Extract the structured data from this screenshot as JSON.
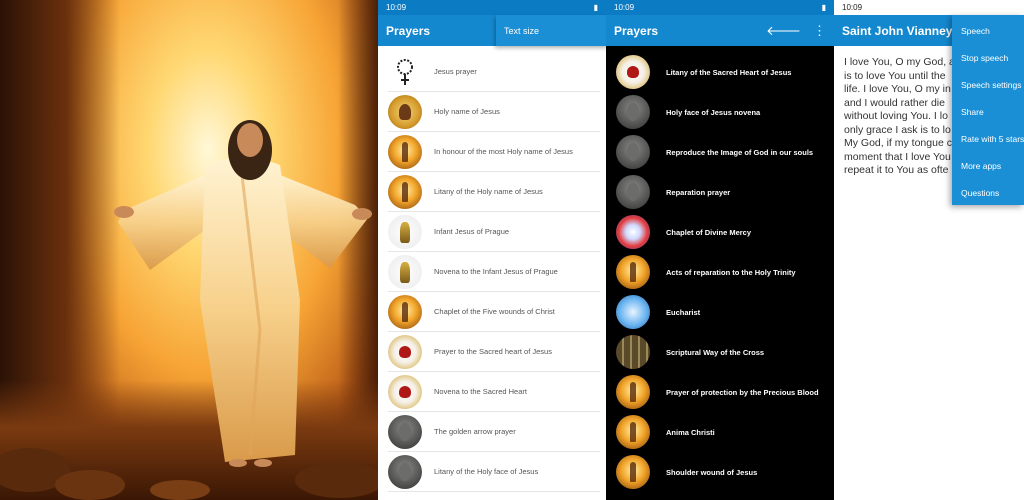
{
  "panel2": {
    "status_time": "10:09",
    "title": "Prayers",
    "popup_label": "Text size",
    "items": [
      {
        "label": "Jesus prayer",
        "icon": "rosary-icon"
      },
      {
        "label": "Holy name of Jesus",
        "icon": "christ-icon"
      },
      {
        "label": "In honour of the most Holy name of Jesus",
        "icon": "risen-christ-icon"
      },
      {
        "label": "Litany of the Holy name of Jesus",
        "icon": "risen-christ-icon"
      },
      {
        "label": "Infant Jesus of Prague",
        "icon": "infant-jesus-icon"
      },
      {
        "label": "Novena to the Infant Jesus of Prague",
        "icon": "infant-jesus-icon"
      },
      {
        "label": "Chaplet of the Five wounds of Christ",
        "icon": "risen-christ-icon"
      },
      {
        "label": "Prayer to the Sacred heart of Jesus",
        "icon": "sacred-heart-icon"
      },
      {
        "label": "Novena to the Sacred Heart",
        "icon": "sacred-heart-icon"
      },
      {
        "label": "The golden arrow prayer",
        "icon": "holy-face-icon"
      },
      {
        "label": "Litany of the Holy face of Jesus",
        "icon": "holy-face-icon"
      }
    ]
  },
  "panel3": {
    "status_time": "10:09",
    "title": "Prayers",
    "back_glyph": "🡐",
    "more_glyph": "⋮",
    "items": [
      {
        "label": "Litany of the Sacred Heart of Jesus",
        "icon": "sacred-heart-icon"
      },
      {
        "label": "Holy face of Jesus novena",
        "icon": "holy-face-icon"
      },
      {
        "label": "Reproduce the Image of God in our souls",
        "icon": "holy-face-icon"
      },
      {
        "label": "Reparation prayer",
        "icon": "holy-face-icon"
      },
      {
        "label": "Chaplet of Divine Mercy",
        "icon": "divine-mercy-icon"
      },
      {
        "label": "Acts of reparation to the Holy Trinity",
        "icon": "risen-christ-icon"
      },
      {
        "label": "Eucharist",
        "icon": "eucharist-icon"
      },
      {
        "label": "Scriptural Way of the Cross",
        "icon": "way-of-cross-icon"
      },
      {
        "label": "Prayer of protection by the Precious Blood",
        "icon": "risen-christ-icon"
      },
      {
        "label": "Anima Christi",
        "icon": "risen-christ-icon"
      },
      {
        "label": "Shoulder wound of Jesus",
        "icon": "risen-christ-icon"
      }
    ]
  },
  "panel4": {
    "status_time": "10:09",
    "title": "Saint John Vianney's p",
    "body_lines": [
      "I love You, O my God, a",
      "is to love You until the",
      "life. I love You, O my in",
      "and I would rather die",
      "without loving You. I lo",
      "only grace I ask is to lo",
      "My God, if my tongue c",
      "moment that I love You",
      "repeat it to You as ofte"
    ],
    "menu": [
      "Speech",
      "Stop speech",
      "Speech settings",
      "Share",
      "Rate with 5 stars",
      "More apps",
      "Questions"
    ]
  },
  "colors": {
    "appbar": "#1488cf",
    "statusbar": "#0b7bc4",
    "menu": "#1a8fd6"
  }
}
